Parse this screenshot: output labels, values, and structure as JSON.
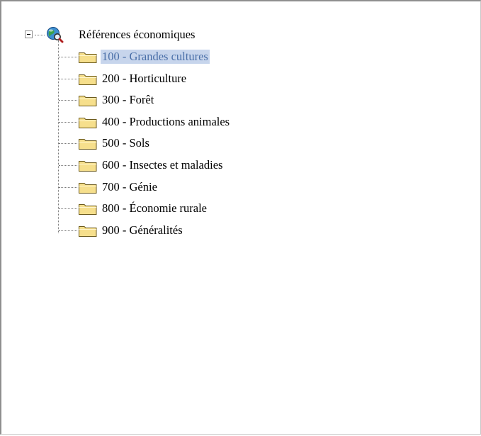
{
  "tree": {
    "root": {
      "label": "Références économiques",
      "icon": "globe-search-icon",
      "expanded": true
    },
    "items": [
      {
        "label": "100 - Grandes cultures",
        "icon": "folder-icon",
        "selected": true
      },
      {
        "label": "200 - Horticulture",
        "icon": "folder-icon",
        "selected": false
      },
      {
        "label": "300 - Forêt",
        "icon": "folder-icon",
        "selected": false
      },
      {
        "label": "400 - Productions animales",
        "icon": "folder-icon",
        "selected": false
      },
      {
        "label": "500 - Sols",
        "icon": "folder-icon",
        "selected": false
      },
      {
        "label": "600 - Insectes et maladies",
        "icon": "folder-icon",
        "selected": false
      },
      {
        "label": "700 - Génie",
        "icon": "folder-icon",
        "selected": false
      },
      {
        "label": "800 - Économie rurale",
        "icon": "folder-icon",
        "selected": false
      },
      {
        "label": "900 - Généralités",
        "icon": "folder-icon",
        "selected": false
      }
    ]
  },
  "colors": {
    "selection_background": "#c7d5ec",
    "selection_text": "#4a6fa8",
    "folder_fill": "#f6df8c",
    "folder_outline": "#6b5a1e"
  }
}
